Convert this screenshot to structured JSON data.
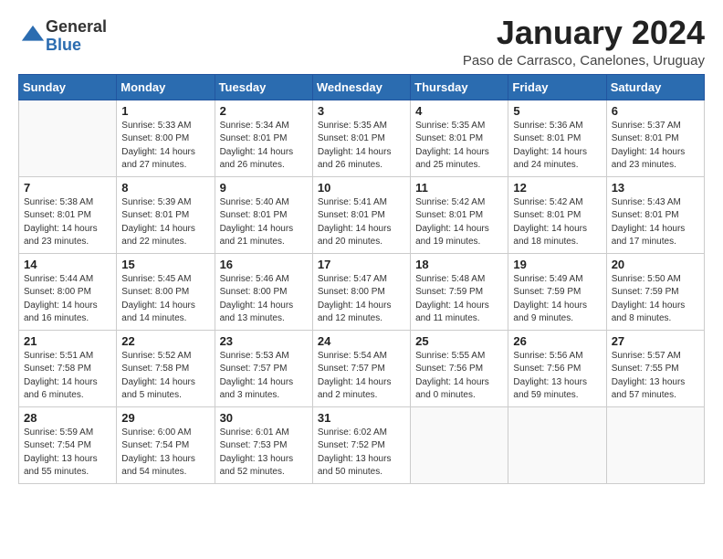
{
  "logo": {
    "general": "General",
    "blue": "Blue"
  },
  "title": "January 2024",
  "location": "Paso de Carrasco, Canelones, Uruguay",
  "days_header": [
    "Sunday",
    "Monday",
    "Tuesday",
    "Wednesday",
    "Thursday",
    "Friday",
    "Saturday"
  ],
  "weeks": [
    [
      {
        "day": "",
        "info": ""
      },
      {
        "day": "1",
        "info": "Sunrise: 5:33 AM\nSunset: 8:00 PM\nDaylight: 14 hours\nand 27 minutes."
      },
      {
        "day": "2",
        "info": "Sunrise: 5:34 AM\nSunset: 8:01 PM\nDaylight: 14 hours\nand 26 minutes."
      },
      {
        "day": "3",
        "info": "Sunrise: 5:35 AM\nSunset: 8:01 PM\nDaylight: 14 hours\nand 26 minutes."
      },
      {
        "day": "4",
        "info": "Sunrise: 5:35 AM\nSunset: 8:01 PM\nDaylight: 14 hours\nand 25 minutes."
      },
      {
        "day": "5",
        "info": "Sunrise: 5:36 AM\nSunset: 8:01 PM\nDaylight: 14 hours\nand 24 minutes."
      },
      {
        "day": "6",
        "info": "Sunrise: 5:37 AM\nSunset: 8:01 PM\nDaylight: 14 hours\nand 23 minutes."
      }
    ],
    [
      {
        "day": "7",
        "info": "Sunrise: 5:38 AM\nSunset: 8:01 PM\nDaylight: 14 hours\nand 23 minutes."
      },
      {
        "day": "8",
        "info": "Sunrise: 5:39 AM\nSunset: 8:01 PM\nDaylight: 14 hours\nand 22 minutes."
      },
      {
        "day": "9",
        "info": "Sunrise: 5:40 AM\nSunset: 8:01 PM\nDaylight: 14 hours\nand 21 minutes."
      },
      {
        "day": "10",
        "info": "Sunrise: 5:41 AM\nSunset: 8:01 PM\nDaylight: 14 hours\nand 20 minutes."
      },
      {
        "day": "11",
        "info": "Sunrise: 5:42 AM\nSunset: 8:01 PM\nDaylight: 14 hours\nand 19 minutes."
      },
      {
        "day": "12",
        "info": "Sunrise: 5:42 AM\nSunset: 8:01 PM\nDaylight: 14 hours\nand 18 minutes."
      },
      {
        "day": "13",
        "info": "Sunrise: 5:43 AM\nSunset: 8:01 PM\nDaylight: 14 hours\nand 17 minutes."
      }
    ],
    [
      {
        "day": "14",
        "info": "Sunrise: 5:44 AM\nSunset: 8:00 PM\nDaylight: 14 hours\nand 16 minutes."
      },
      {
        "day": "15",
        "info": "Sunrise: 5:45 AM\nSunset: 8:00 PM\nDaylight: 14 hours\nand 14 minutes."
      },
      {
        "day": "16",
        "info": "Sunrise: 5:46 AM\nSunset: 8:00 PM\nDaylight: 14 hours\nand 13 minutes."
      },
      {
        "day": "17",
        "info": "Sunrise: 5:47 AM\nSunset: 8:00 PM\nDaylight: 14 hours\nand 12 minutes."
      },
      {
        "day": "18",
        "info": "Sunrise: 5:48 AM\nSunset: 7:59 PM\nDaylight: 14 hours\nand 11 minutes."
      },
      {
        "day": "19",
        "info": "Sunrise: 5:49 AM\nSunset: 7:59 PM\nDaylight: 14 hours\nand 9 minutes."
      },
      {
        "day": "20",
        "info": "Sunrise: 5:50 AM\nSunset: 7:59 PM\nDaylight: 14 hours\nand 8 minutes."
      }
    ],
    [
      {
        "day": "21",
        "info": "Sunrise: 5:51 AM\nSunset: 7:58 PM\nDaylight: 14 hours\nand 6 minutes."
      },
      {
        "day": "22",
        "info": "Sunrise: 5:52 AM\nSunset: 7:58 PM\nDaylight: 14 hours\nand 5 minutes."
      },
      {
        "day": "23",
        "info": "Sunrise: 5:53 AM\nSunset: 7:57 PM\nDaylight: 14 hours\nand 3 minutes."
      },
      {
        "day": "24",
        "info": "Sunrise: 5:54 AM\nSunset: 7:57 PM\nDaylight: 14 hours\nand 2 minutes."
      },
      {
        "day": "25",
        "info": "Sunrise: 5:55 AM\nSunset: 7:56 PM\nDaylight: 14 hours\nand 0 minutes."
      },
      {
        "day": "26",
        "info": "Sunrise: 5:56 AM\nSunset: 7:56 PM\nDaylight: 13 hours\nand 59 minutes."
      },
      {
        "day": "27",
        "info": "Sunrise: 5:57 AM\nSunset: 7:55 PM\nDaylight: 13 hours\nand 57 minutes."
      }
    ],
    [
      {
        "day": "28",
        "info": "Sunrise: 5:59 AM\nSunset: 7:54 PM\nDaylight: 13 hours\nand 55 minutes."
      },
      {
        "day": "29",
        "info": "Sunrise: 6:00 AM\nSunset: 7:54 PM\nDaylight: 13 hours\nand 54 minutes."
      },
      {
        "day": "30",
        "info": "Sunrise: 6:01 AM\nSunset: 7:53 PM\nDaylight: 13 hours\nand 52 minutes."
      },
      {
        "day": "31",
        "info": "Sunrise: 6:02 AM\nSunset: 7:52 PM\nDaylight: 13 hours\nand 50 minutes."
      },
      {
        "day": "",
        "info": ""
      },
      {
        "day": "",
        "info": ""
      },
      {
        "day": "",
        "info": ""
      }
    ]
  ]
}
